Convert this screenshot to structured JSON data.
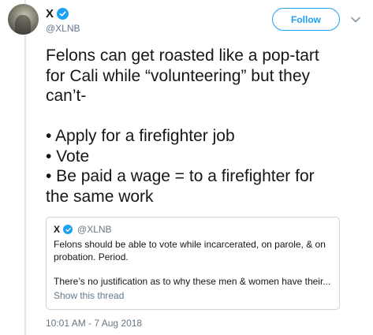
{
  "tweet": {
    "display_name": "X",
    "handle": "@XLNB",
    "follow_label": "Follow",
    "text_lines": [
      "Felons can get roasted like a pop-tart",
      "for Cali while “volunteering” but they",
      "can’t-",
      "• Apply for a firefighter job",
      "• Vote",
      "• Be paid a wage = to a firefighter for",
      "the same work"
    ],
    "timestamp": "10:01 AM - 7 Aug 2018"
  },
  "quote": {
    "display_name": "X",
    "handle": "@XLNB",
    "text_line_1": "Felons should be able to vote while incarcerated, on parole, & on",
    "text_line_2": "probation. Period.",
    "text_line_3": "There’s no justification as to why these men & women have their...",
    "show_thread": "Show this thread"
  },
  "colors": {
    "accent": "#1da1f2",
    "secondary_text": "#657786",
    "border": "#ccd6dd"
  },
  "icons": [
    "verified-badge-icon",
    "chevron-down-icon"
  ]
}
